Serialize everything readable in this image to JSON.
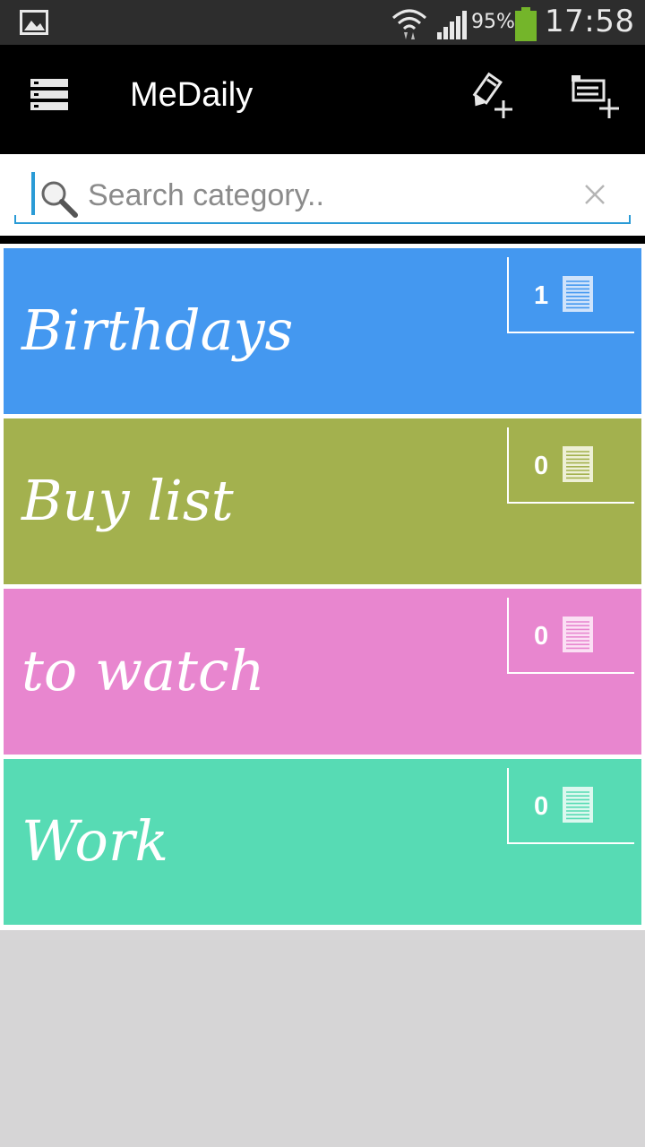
{
  "status_bar": {
    "battery_percent": "95%",
    "time": "17:58"
  },
  "app_bar": {
    "title": "MeDaily",
    "icons": [
      "list-menu-icon",
      "add-note-icon",
      "add-category-icon"
    ]
  },
  "search": {
    "placeholder": "Search category..",
    "value": ""
  },
  "categories": [
    {
      "name": "Birthdays",
      "count": "1",
      "color": "#4498f0",
      "icon_color": "#cfe3fb"
    },
    {
      "name": "Buy list",
      "count": "0",
      "color": "#a3b14e",
      "icon_color": "#eef0d6"
    },
    {
      "name": "to watch",
      "count": "0",
      "color": "#e886cf",
      "icon_color": "#fbe0f4"
    },
    {
      "name": "Work",
      "count": "0",
      "color": "#57dbb4",
      "icon_color": "#dcf8ef"
    }
  ]
}
